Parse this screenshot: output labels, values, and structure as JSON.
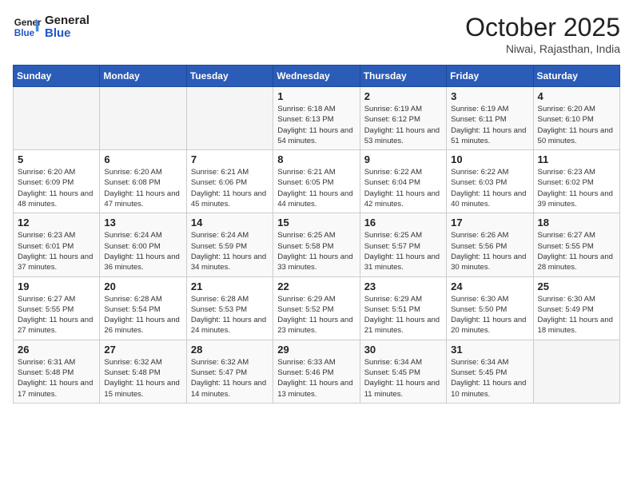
{
  "header": {
    "logo_text_general": "General",
    "logo_text_blue": "Blue",
    "month_title": "October 2025",
    "location": "Niwai, Rajasthan, India"
  },
  "days_of_week": [
    "Sunday",
    "Monday",
    "Tuesday",
    "Wednesday",
    "Thursday",
    "Friday",
    "Saturday"
  ],
  "weeks": [
    [
      {
        "day": "",
        "info": ""
      },
      {
        "day": "",
        "info": ""
      },
      {
        "day": "",
        "info": ""
      },
      {
        "day": "1",
        "info": "Sunrise: 6:18 AM\nSunset: 6:13 PM\nDaylight: 11 hours and 54 minutes."
      },
      {
        "day": "2",
        "info": "Sunrise: 6:19 AM\nSunset: 6:12 PM\nDaylight: 11 hours and 53 minutes."
      },
      {
        "day": "3",
        "info": "Sunrise: 6:19 AM\nSunset: 6:11 PM\nDaylight: 11 hours and 51 minutes."
      },
      {
        "day": "4",
        "info": "Sunrise: 6:20 AM\nSunset: 6:10 PM\nDaylight: 11 hours and 50 minutes."
      }
    ],
    [
      {
        "day": "5",
        "info": "Sunrise: 6:20 AM\nSunset: 6:09 PM\nDaylight: 11 hours and 48 minutes."
      },
      {
        "day": "6",
        "info": "Sunrise: 6:20 AM\nSunset: 6:08 PM\nDaylight: 11 hours and 47 minutes."
      },
      {
        "day": "7",
        "info": "Sunrise: 6:21 AM\nSunset: 6:06 PM\nDaylight: 11 hours and 45 minutes."
      },
      {
        "day": "8",
        "info": "Sunrise: 6:21 AM\nSunset: 6:05 PM\nDaylight: 11 hours and 44 minutes."
      },
      {
        "day": "9",
        "info": "Sunrise: 6:22 AM\nSunset: 6:04 PM\nDaylight: 11 hours and 42 minutes."
      },
      {
        "day": "10",
        "info": "Sunrise: 6:22 AM\nSunset: 6:03 PM\nDaylight: 11 hours and 40 minutes."
      },
      {
        "day": "11",
        "info": "Sunrise: 6:23 AM\nSunset: 6:02 PM\nDaylight: 11 hours and 39 minutes."
      }
    ],
    [
      {
        "day": "12",
        "info": "Sunrise: 6:23 AM\nSunset: 6:01 PM\nDaylight: 11 hours and 37 minutes."
      },
      {
        "day": "13",
        "info": "Sunrise: 6:24 AM\nSunset: 6:00 PM\nDaylight: 11 hours and 36 minutes."
      },
      {
        "day": "14",
        "info": "Sunrise: 6:24 AM\nSunset: 5:59 PM\nDaylight: 11 hours and 34 minutes."
      },
      {
        "day": "15",
        "info": "Sunrise: 6:25 AM\nSunset: 5:58 PM\nDaylight: 11 hours and 33 minutes."
      },
      {
        "day": "16",
        "info": "Sunrise: 6:25 AM\nSunset: 5:57 PM\nDaylight: 11 hours and 31 minutes."
      },
      {
        "day": "17",
        "info": "Sunrise: 6:26 AM\nSunset: 5:56 PM\nDaylight: 11 hours and 30 minutes."
      },
      {
        "day": "18",
        "info": "Sunrise: 6:27 AM\nSunset: 5:55 PM\nDaylight: 11 hours and 28 minutes."
      }
    ],
    [
      {
        "day": "19",
        "info": "Sunrise: 6:27 AM\nSunset: 5:55 PM\nDaylight: 11 hours and 27 minutes."
      },
      {
        "day": "20",
        "info": "Sunrise: 6:28 AM\nSunset: 5:54 PM\nDaylight: 11 hours and 26 minutes."
      },
      {
        "day": "21",
        "info": "Sunrise: 6:28 AM\nSunset: 5:53 PM\nDaylight: 11 hours and 24 minutes."
      },
      {
        "day": "22",
        "info": "Sunrise: 6:29 AM\nSunset: 5:52 PM\nDaylight: 11 hours and 23 minutes."
      },
      {
        "day": "23",
        "info": "Sunrise: 6:29 AM\nSunset: 5:51 PM\nDaylight: 11 hours and 21 minutes."
      },
      {
        "day": "24",
        "info": "Sunrise: 6:30 AM\nSunset: 5:50 PM\nDaylight: 11 hours and 20 minutes."
      },
      {
        "day": "25",
        "info": "Sunrise: 6:30 AM\nSunset: 5:49 PM\nDaylight: 11 hours and 18 minutes."
      }
    ],
    [
      {
        "day": "26",
        "info": "Sunrise: 6:31 AM\nSunset: 5:48 PM\nDaylight: 11 hours and 17 minutes."
      },
      {
        "day": "27",
        "info": "Sunrise: 6:32 AM\nSunset: 5:48 PM\nDaylight: 11 hours and 15 minutes."
      },
      {
        "day": "28",
        "info": "Sunrise: 6:32 AM\nSunset: 5:47 PM\nDaylight: 11 hours and 14 minutes."
      },
      {
        "day": "29",
        "info": "Sunrise: 6:33 AM\nSunset: 5:46 PM\nDaylight: 11 hours and 13 minutes."
      },
      {
        "day": "30",
        "info": "Sunrise: 6:34 AM\nSunset: 5:45 PM\nDaylight: 11 hours and 11 minutes."
      },
      {
        "day": "31",
        "info": "Sunrise: 6:34 AM\nSunset: 5:45 PM\nDaylight: 11 hours and 10 minutes."
      },
      {
        "day": "",
        "info": ""
      }
    ]
  ]
}
